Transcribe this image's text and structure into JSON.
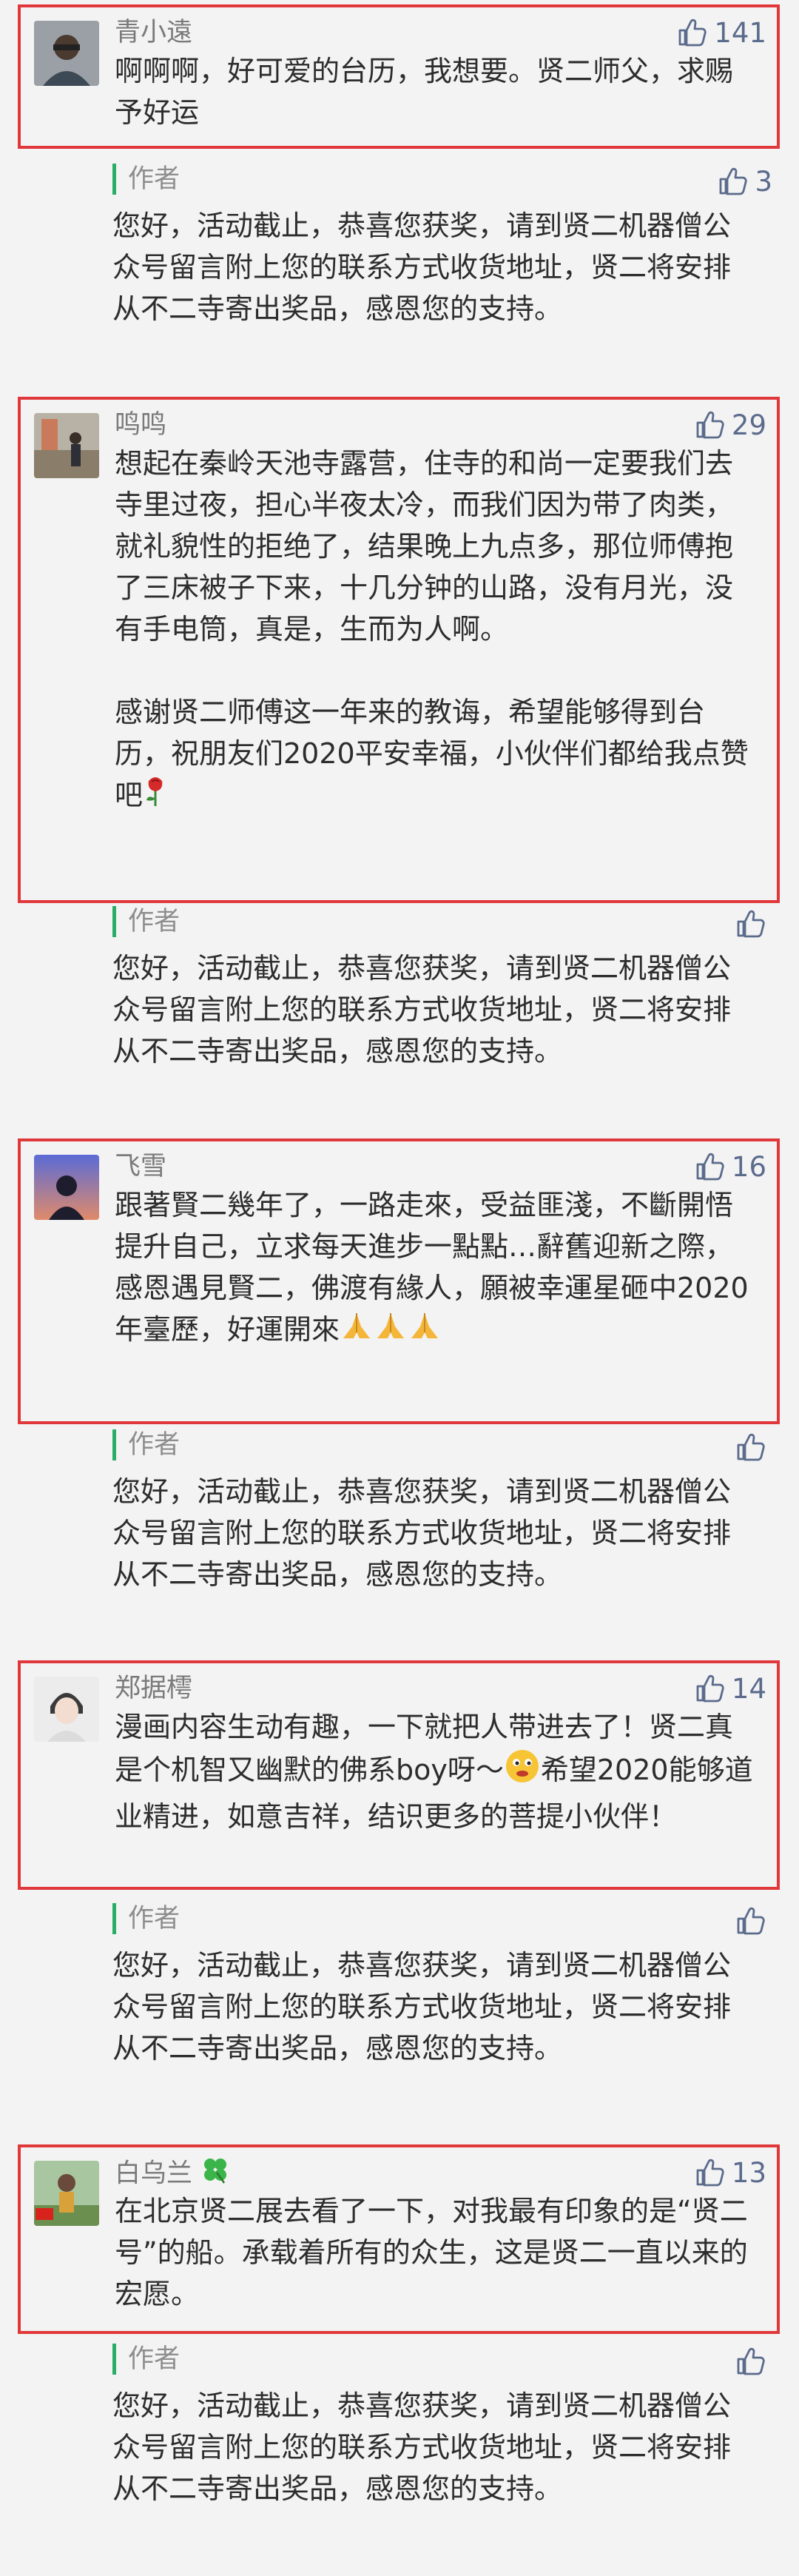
{
  "comments": [
    {
      "user": "青小遠",
      "likes": "141",
      "text": "啊啊啊，好可爱的台历，我想要。贤二师父，求赐予好运",
      "reply": {
        "author": "作者",
        "likes": "3",
        "text": "您好，活动截止，恭喜您获奖，请到贤二机器僧公众号留言附上您的联系方式收货地址，贤二将安排从不二寺寄出奖品，感恩您的支持。"
      }
    },
    {
      "user": "鸣鸣",
      "likes": "29",
      "text1": "想起在秦岭天池寺露营，住寺的和尚一定要我们去寺里过夜，担心半夜太冷，而我们因为带了肉类，就礼貌性的拒绝了，结果晚上九点多，那位师傅抱了三床被子下来，十几分钟的山路，没有月光，没有手电筒，真是，生而为人啊。",
      "text2": "感谢贤二师傅这一年来的教诲，希望能够得到台历，祝朋友们2020平安幸福，小伙伴们都给我点赞吧",
      "reply": {
        "author": "作者",
        "likes": "",
        "text": "您好，活动截止，恭喜您获奖，请到贤二机器僧公众号留言附上您的联系方式收货地址，贤二将安排从不二寺寄出奖品，感恩您的支持。"
      }
    },
    {
      "user": "飞雪",
      "likes": "16",
      "text": "跟著賢二幾年了，一路走來，受益匪淺，不斷開悟提升自己，立求每天進步一點點…辭舊迎新之際，感恩遇見賢二，佛渡有緣人，願被幸運星砸中2020年臺歷，好運開來",
      "reply": {
        "author": "作者",
        "likes": "",
        "text": "您好，活动截止，恭喜您获奖，请到贤二机器僧公众号留言附上您的联系方式收货地址，贤二将安排从不二寺寄出奖品，感恩您的支持。"
      }
    },
    {
      "user": "郑据樗",
      "likes": "14",
      "text_a": "漫画内容生动有趣，一下就把人带进去了！贤二真是个机智又幽默的佛系boy呀～",
      "text_b": "希望2020能够道业精进，如意吉祥，结识更多的菩提小伙伴！",
      "reply": {
        "author": "作者",
        "likes": "",
        "text": "您好，活动截止，恭喜您获奖，请到贤二机器僧公众号留言附上您的联系方式收货地址，贤二将安排从不二寺寄出奖品，感恩您的支持。"
      }
    },
    {
      "user": "白乌兰",
      "likes": "13",
      "text": "在北京贤二展去看了一下，对我最有印象的是“贤二号”的船。承载着所有的众生，这是贤二一直以来的宏愿。",
      "reply": {
        "author": "作者",
        "likes": "",
        "text": "您好，活动截止，恭喜您获奖，请到贤二机器僧公众号留言附上您的联系方式收货地址，贤二将安排从不二寺寄出奖品，感恩您的支持。"
      }
    }
  ],
  "icons": {
    "like": "thumbs-up-icon",
    "rose": "rose-emoji",
    "pray": "praying-hands-emoji",
    "smile": "grinning-face-emoji",
    "clover": "four-leaf-clover-emoji"
  },
  "colors": {
    "border": "#e0383a",
    "like": "#5b6b8c",
    "author_bar": "#2aae67"
  }
}
